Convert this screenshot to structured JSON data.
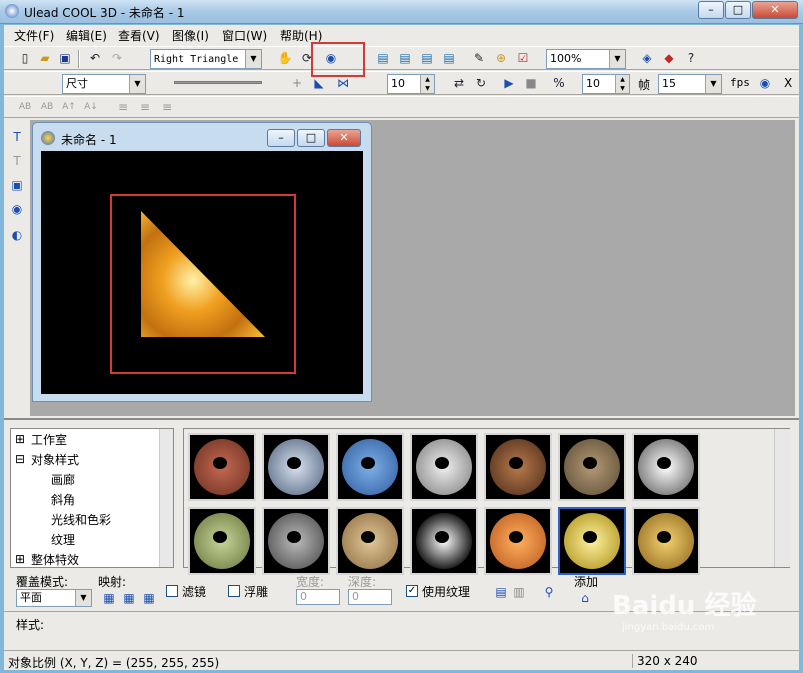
{
  "window": {
    "title": "Ulead COOL 3D - 未命名 - 1",
    "buttons": {
      "minimize": "–",
      "maximize": "□",
      "close": "✕"
    }
  },
  "menu": [
    "文件(F)",
    "编辑(E)",
    "查看(V)",
    "图像(I)",
    "窗口(W)",
    "帮助(H)"
  ],
  "toolbar1": {
    "shape_select": "Right Triangle",
    "zoom": "100%"
  },
  "toolbar2": {
    "attribute_select": "尺寸",
    "frame_value": "10",
    "frames_value": "10",
    "frames_label": "帧",
    "fps_value": "15",
    "fps_label": "fps",
    "coord_label": "X"
  },
  "document": {
    "title": "未命名 - 1",
    "canvas_bg": "#000000"
  },
  "tree": [
    "工作室",
    "对象样式",
    "画廊",
    "斜角",
    "光线和色彩",
    "纹理",
    "整体特效"
  ],
  "options": {
    "overlay_label": "覆盖模式:",
    "overlay_value": "平面",
    "mapping_label": "映射:",
    "filter_label": "滤镜",
    "emboss_label": "浮雕",
    "width_label": "宽度:",
    "width_value": "0",
    "depth_label": "深度:",
    "depth_value": "0",
    "use_texture_label": "使用纹理",
    "use_texture_checked": "✓",
    "add_label": "添加",
    "style_label": "样式:"
  },
  "status": {
    "text": "对象比例 (X, Y, Z) = (255, 255, 255)",
    "size": "320 x 240"
  },
  "watermark": {
    "text": "Baidu 经验",
    "sub": "jingyan.baidu.com"
  },
  "accents": {
    "highlight": "#d23b35",
    "gold": "#e8a020"
  },
  "thumbnails": [
    "brick",
    "blue-pattern",
    "blue-bumpy",
    "white-brick",
    "wood-brick",
    "stone",
    "silver-crackle",
    "green-moss",
    "gray-rock",
    "tan-stone",
    "chrome",
    "orange",
    "gold-metal",
    "bronze"
  ]
}
